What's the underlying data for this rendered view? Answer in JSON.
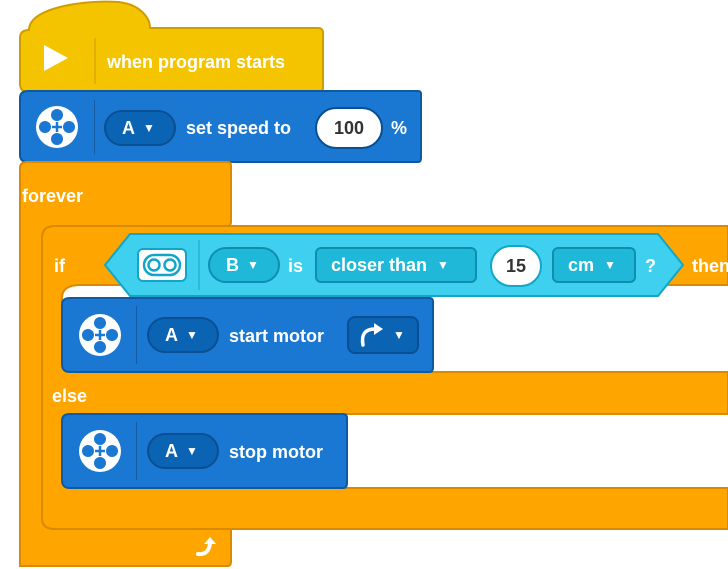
{
  "hat_block": {
    "label": "when program starts",
    "icon": "play-icon",
    "color": "#f5c400"
  },
  "set_speed_block": {
    "port": "A",
    "label": "set speed to",
    "value": "100",
    "unit": "%",
    "color": "#1a78d2"
  },
  "forever_block": {
    "label": "forever",
    "loop_icon": "loop-arrow-icon",
    "color": "#ffa500"
  },
  "if_block": {
    "if_label": "if",
    "then_label": "then",
    "else_label": "else",
    "color": "#ffa500"
  },
  "condition": {
    "sensor_icon": "distance-sensor-icon",
    "port": "B",
    "is_label": "is",
    "comparison": "closer than",
    "value": "15",
    "unit": "cm",
    "question": "?",
    "color": "#3fd0ef"
  },
  "start_motor_block": {
    "port": "A",
    "label": "start motor",
    "direction_icon": "clockwise-arrow-icon"
  },
  "stop_motor_block": {
    "port": "A",
    "label": "stop motor"
  }
}
